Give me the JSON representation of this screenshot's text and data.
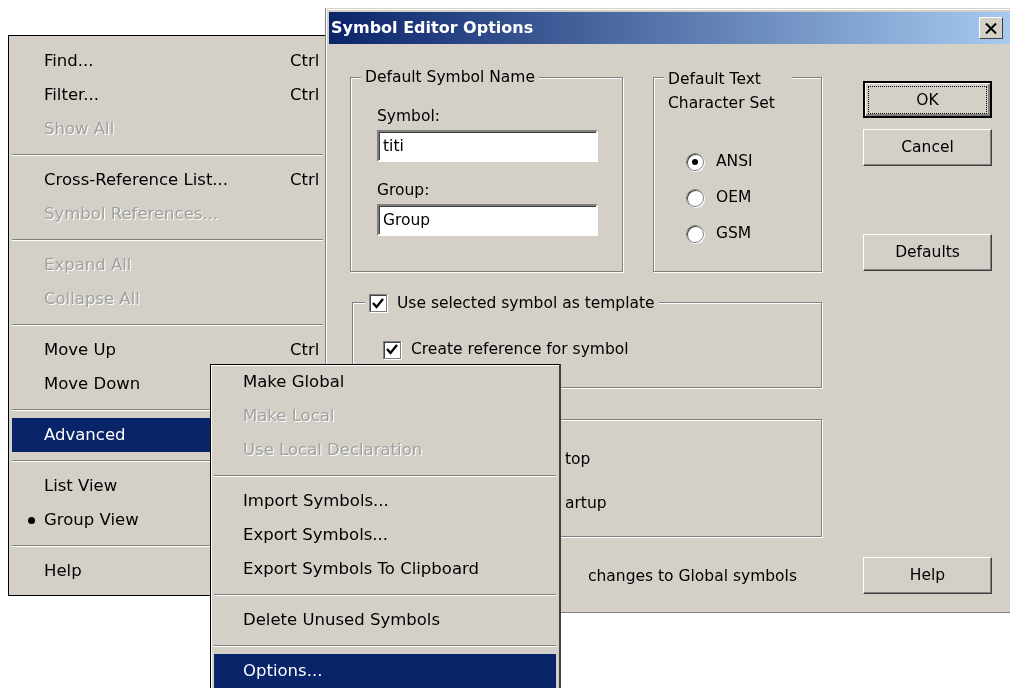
{
  "context_menu": {
    "items": [
      {
        "kind": "item",
        "label": "Find...",
        "shortcut": "Ctrl",
        "disabled": false,
        "selected": false
      },
      {
        "kind": "item",
        "label": "Filter...",
        "shortcut": "Ctrl",
        "disabled": false,
        "selected": false
      },
      {
        "kind": "item",
        "label": "Show All",
        "disabled": true,
        "selected": false
      },
      {
        "kind": "separator"
      },
      {
        "kind": "item",
        "label": "Cross-Reference List...",
        "shortcut": "Ctrl",
        "disabled": false,
        "selected": false
      },
      {
        "kind": "item",
        "label": "Symbol References...",
        "disabled": true,
        "selected": false
      },
      {
        "kind": "separator"
      },
      {
        "kind": "item",
        "label": "Expand All",
        "disabled": true,
        "selected": false
      },
      {
        "kind": "item",
        "label": "Collapse All",
        "disabled": true,
        "selected": false
      },
      {
        "kind": "separator"
      },
      {
        "kind": "item",
        "label": "Move Up",
        "shortcut": "Ctrl",
        "disabled": false,
        "selected": false
      },
      {
        "kind": "item",
        "label": "Move Down",
        "disabled": false,
        "selected": false
      },
      {
        "kind": "separator"
      },
      {
        "kind": "item",
        "label": "Advanced",
        "disabled": false,
        "selected": true
      },
      {
        "kind": "separator"
      },
      {
        "kind": "radio",
        "label": "List View",
        "checked": false,
        "disabled": false,
        "selected": false
      },
      {
        "kind": "radio",
        "label": "Group View",
        "checked": true,
        "disabled": false,
        "selected": false
      },
      {
        "kind": "separator"
      },
      {
        "kind": "item",
        "label": "Help",
        "disabled": false,
        "selected": false
      }
    ]
  },
  "submenu": {
    "items": [
      {
        "kind": "item",
        "label": "Make Global",
        "disabled": false,
        "selected": false
      },
      {
        "kind": "item",
        "label": "Make Local",
        "disabled": true,
        "selected": false
      },
      {
        "kind": "item",
        "label": "Use Local Declaration",
        "disabled": true,
        "selected": false
      },
      {
        "kind": "separator"
      },
      {
        "kind": "item",
        "label": "Import Symbols...",
        "disabled": false,
        "selected": false
      },
      {
        "kind": "item",
        "label": "Export Symbols...",
        "disabled": false,
        "selected": false
      },
      {
        "kind": "item",
        "label": "Export Symbols To Clipboard",
        "disabled": false,
        "selected": false
      },
      {
        "kind": "separator"
      },
      {
        "kind": "item",
        "label": "Delete Unused Symbols",
        "disabled": false,
        "selected": false
      },
      {
        "kind": "separator"
      },
      {
        "kind": "item",
        "label": "Options...",
        "disabled": false,
        "selected": true
      }
    ]
  },
  "dialog": {
    "title": "Symbol Editor Options",
    "name_group": {
      "title": "Default Symbol Name",
      "fields": [
        {
          "label": "Symbol:",
          "value": "titi"
        },
        {
          "label": "Group:",
          "value": "Group"
        }
      ]
    },
    "charset_group": {
      "title": "Default Text Character Set",
      "options": [
        {
          "label": "ANSI",
          "selected": true
        },
        {
          "label": "OEM",
          "selected": false
        },
        {
          "label": "GSM",
          "selected": false
        }
      ]
    },
    "template_group": {
      "checkbox": {
        "label": "Use selected symbol as template",
        "checked": true
      },
      "options": [
        {
          "label": "Create reference for symbol",
          "checked": true
        }
      ]
    },
    "covered_group": {
      "texts": [
        "top",
        "artup"
      ]
    },
    "covered_text": "changes to Global symbols",
    "buttons": [
      {
        "label": "OK",
        "focused": true
      },
      {
        "label": "Cancel",
        "focused": false
      },
      {
        "label": "Defaults",
        "focused": false
      },
      {
        "label": "Help",
        "focused": false
      }
    ]
  }
}
